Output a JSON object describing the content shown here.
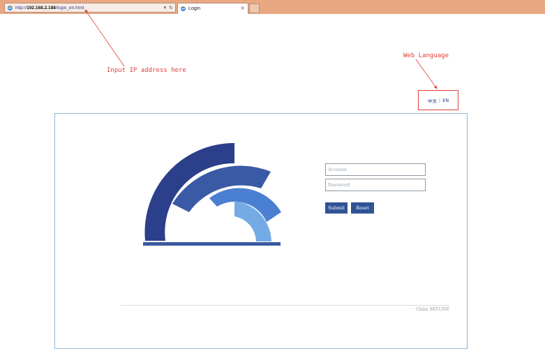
{
  "browser": {
    "url_prefix": "http://",
    "url_host": "192.168.2.188",
    "url_path": "/login_en.html",
    "tab_title": "Login",
    "tab_close": "×",
    "dropdown_glyph": "▾",
    "refresh_glyph": "↻"
  },
  "annotations": {
    "ip_hint": "Input IP address here",
    "lang_hint": "Web Language"
  },
  "language": {
    "chinese": "中文",
    "separator": "|",
    "english": "EN"
  },
  "login": {
    "account_placeholder": "Account",
    "password_placeholder": "Password",
    "submit_label": "Submit",
    "reset_label": "Reset"
  },
  "footer": {
    "copyright": "China SKYLINE"
  },
  "colors": {
    "chrome": "#e9a782",
    "annotation": "#e0403a",
    "button": "#2f5496",
    "panel_border": "#8fb8d6",
    "logo_arc_1": "#2b3f8a",
    "logo_arc_2": "#3a5aa6",
    "logo_arc_3": "#4a7fd1",
    "logo_arc_4": "#74abe4",
    "logo_base": "#3a5aa0"
  }
}
